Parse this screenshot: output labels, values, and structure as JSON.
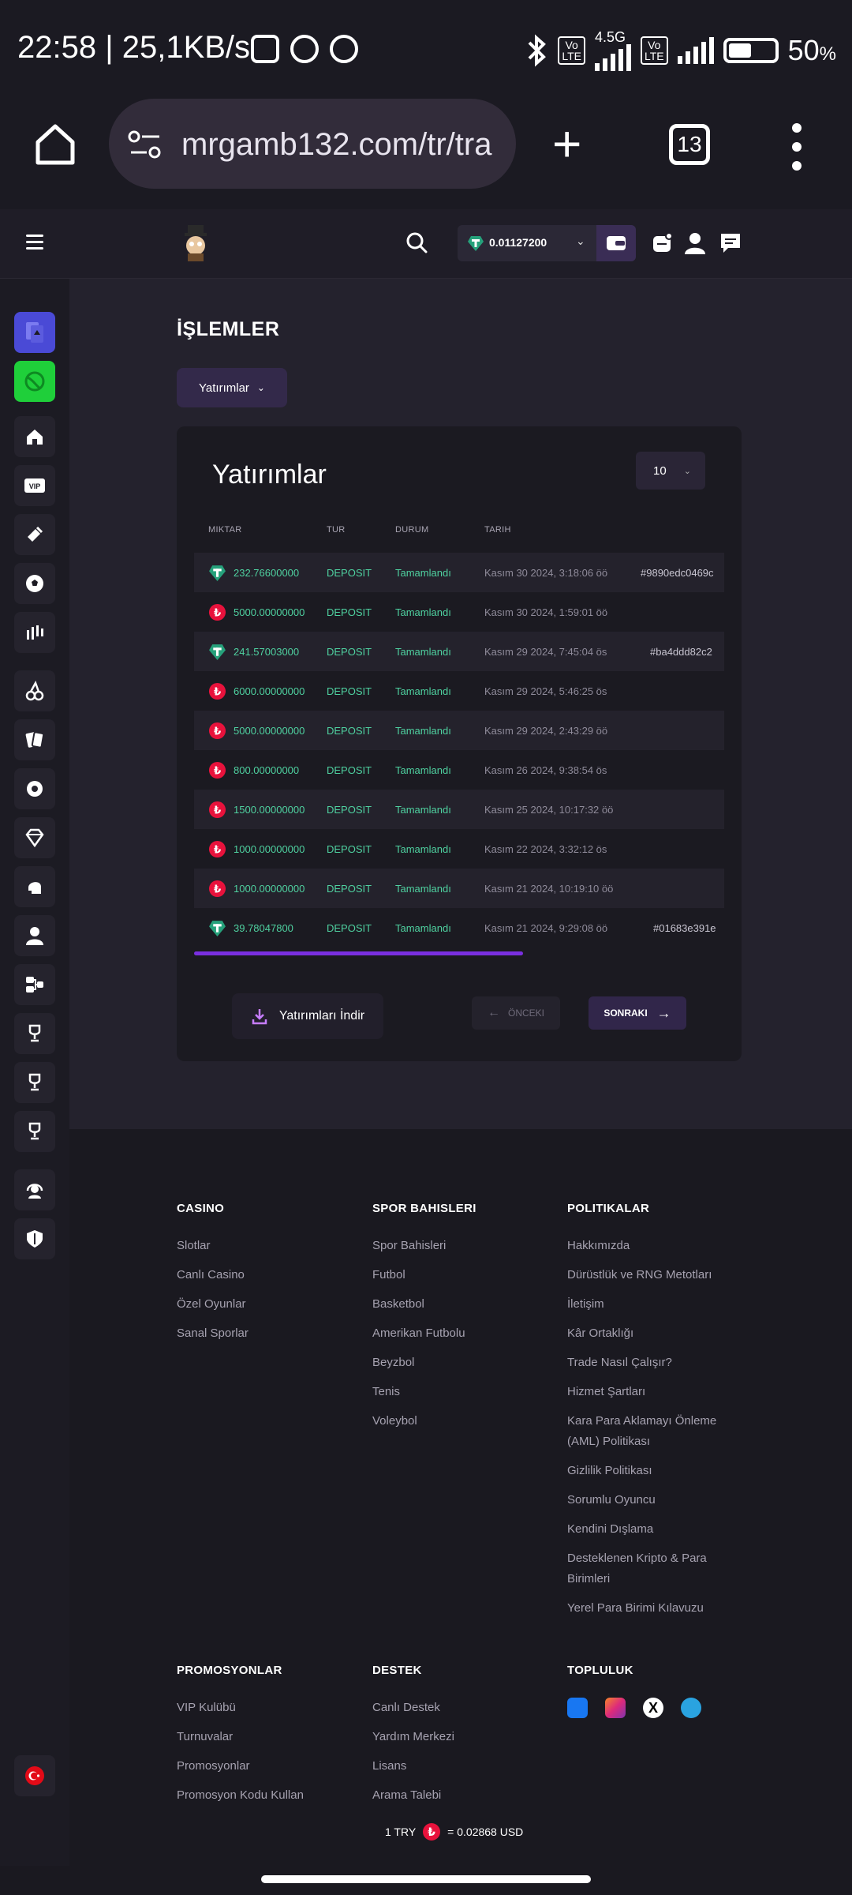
{
  "status_bar": {
    "time_speed": "22:58 | 25,1KB/s",
    "network": "4.5G",
    "volte": "Vo LTE",
    "battery": "50",
    "battery_unit": "%"
  },
  "browser": {
    "url": "mrgamb132.com/tr/tra",
    "tab_count": "13"
  },
  "header": {
    "balance": "0.01127200",
    "chevron": "⌄"
  },
  "page": {
    "title": "İŞLEMLER",
    "filter_label": "Yatırımlar"
  },
  "panel": {
    "title": "Yatırımlar",
    "per_page": "10",
    "columns": [
      "MIKTAR",
      "TUR",
      "DURUM",
      "TARIH"
    ],
    "rows": [
      {
        "currency": "usdt",
        "amount": "232.76600000",
        "type": "DEPOSIT",
        "status": "Tamamlandı",
        "date": "Kasım 30 2024, 3:18:06 öö",
        "hash": "#9890edc0469c"
      },
      {
        "currency": "try",
        "amount": "5000.00000000",
        "type": "DEPOSIT",
        "status": "Tamamlandı",
        "date": "Kasım 30 2024, 1:59:01 öö",
        "hash": ""
      },
      {
        "currency": "usdt",
        "amount": "241.57003000",
        "type": "DEPOSIT",
        "status": "Tamamlandı",
        "date": "Kasım 29 2024, 7:45:04 ös",
        "hash": "#ba4ddd82c2"
      },
      {
        "currency": "try",
        "amount": "6000.00000000",
        "type": "DEPOSIT",
        "status": "Tamamlandı",
        "date": "Kasım 29 2024, 5:46:25 ös",
        "hash": ""
      },
      {
        "currency": "try",
        "amount": "5000.00000000",
        "type": "DEPOSIT",
        "status": "Tamamlandı",
        "date": "Kasım 29 2024, 2:43:29 öö",
        "hash": ""
      },
      {
        "currency": "try",
        "amount": "800.00000000",
        "type": "DEPOSIT",
        "status": "Tamamlandı",
        "date": "Kasım 26 2024, 9:38:54 ös",
        "hash": ""
      },
      {
        "currency": "try",
        "amount": "1500.00000000",
        "type": "DEPOSIT",
        "status": "Tamamlandı",
        "date": "Kasım 25 2024, 10:17:32 öö",
        "hash": ""
      },
      {
        "currency": "try",
        "amount": "1000.00000000",
        "type": "DEPOSIT",
        "status": "Tamamlandı",
        "date": "Kasım 22 2024, 3:32:12 ös",
        "hash": ""
      },
      {
        "currency": "try",
        "amount": "1000.00000000",
        "type": "DEPOSIT",
        "status": "Tamamlandı",
        "date": "Kasım 21 2024, 10:19:10 öö",
        "hash": ""
      },
      {
        "currency": "usdt",
        "amount": "39.78047800",
        "type": "DEPOSIT",
        "status": "Tamamlandı",
        "date": "Kasım 21 2024, 9:29:08 öö",
        "hash": "#01683e391e"
      }
    ],
    "scroll_fraction": 0.62,
    "download_label": "Yatırımları İndir",
    "prev_label": "ÖNCEKI",
    "next_label": "SONRAKI"
  },
  "footer": {
    "casino": {
      "title": "CASINO",
      "links": [
        "Slotlar",
        "Canlı Casino",
        "Özel Oyunlar",
        "Sanal Sporlar"
      ]
    },
    "sports": {
      "title": "SPOR BAHISLERI",
      "links": [
        "Spor Bahisleri",
        "Futbol",
        "Basketbol",
        "Amerikan Futbolu",
        "Beyzbol",
        "Tenis",
        "Voleybol"
      ]
    },
    "policies": {
      "title": "POLITIKALAR",
      "links": [
        "Hakkımızda",
        "Dürüstlük ve RNG Metotları",
        "İletişim",
        "Kâr Ortaklığı",
        "Trade Nasıl Çalışır?",
        "Hizmet Şartları",
        "Kara Para Aklamayı Önleme (AML) Politikası",
        "Gizlilik Politikası",
        "Sorumlu Oyuncu",
        "Kendini Dışlama",
        "Desteklenen Kripto & Para Birimleri",
        "Yerel Para Birimi Kılavuzu"
      ]
    },
    "promos": {
      "title": "PROMOSYONLAR",
      "links": [
        "VIP Kulübü",
        "Turnuvalar",
        "Promosyonlar",
        "Promosyon Kodu Kullan"
      ]
    },
    "support": {
      "title": "DESTEK",
      "links": [
        "Canlı Destek",
        "Yardım Merkezi",
        "Lisans",
        "Arama Talebi"
      ]
    },
    "community": {
      "title": "TOPLULUK",
      "icons": [
        "facebook-icon",
        "instagram-icon",
        "x-icon",
        "telegram-icon"
      ]
    },
    "rate_left": "1 TRY",
    "rate_right": "= 0.02868 USD"
  },
  "colors": {
    "accent": "#7a2fe0",
    "success": "#4fd1a0",
    "try_red": "#e8123c",
    "usdt_green": "#26a17b"
  }
}
